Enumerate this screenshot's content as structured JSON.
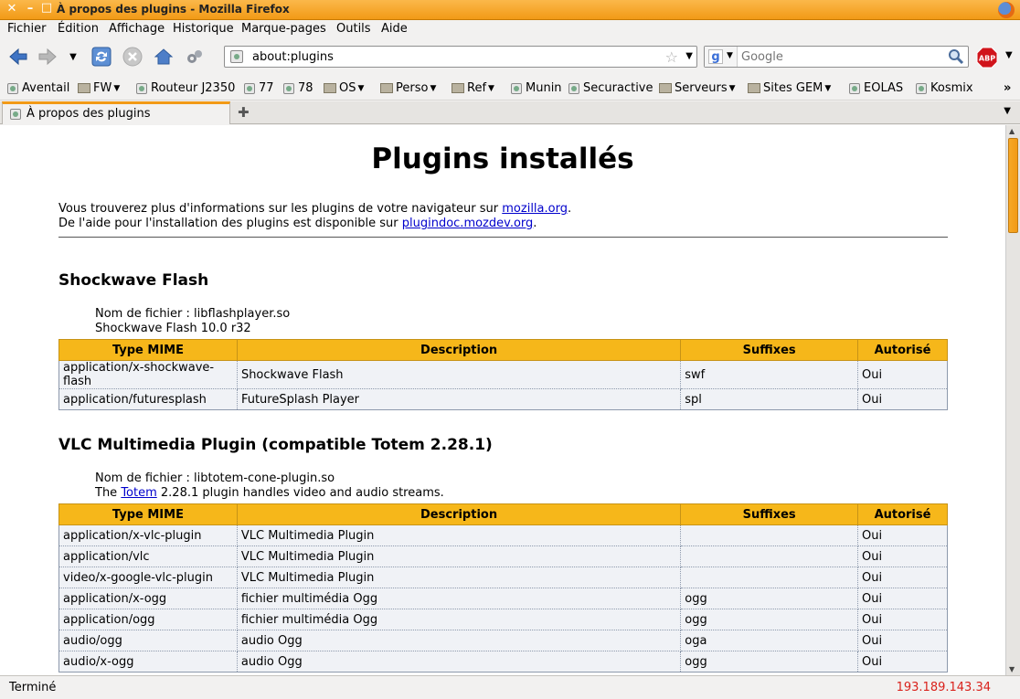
{
  "window": {
    "title": "À propos des plugins - Mozilla Firefox"
  },
  "menubar": [
    "Fichier",
    "Édition",
    "Affichage",
    "Historique",
    "Marque-pages",
    "Outils",
    "Aide"
  ],
  "navbar": {
    "url": "about:plugins",
    "search_placeholder": "Google",
    "search_engine_letter": "g",
    "abp_label": "ABP"
  },
  "bookmarks": [
    {
      "label": "Aventail",
      "kind": "link"
    },
    {
      "label": "FW",
      "kind": "folder"
    },
    {
      "label": "Routeur J2350",
      "kind": "link"
    },
    {
      "label": "77",
      "kind": "link"
    },
    {
      "label": "78",
      "kind": "link"
    },
    {
      "label": "OS",
      "kind": "folder"
    },
    {
      "label": "Perso",
      "kind": "folder"
    },
    {
      "label": "Ref",
      "kind": "folder"
    },
    {
      "label": "Munin",
      "kind": "link"
    },
    {
      "label": "Securactive",
      "kind": "link"
    },
    {
      "label": "Serveurs",
      "kind": "folder"
    },
    {
      "label": "Sites GEM",
      "kind": "folder"
    },
    {
      "label": "EOLAS",
      "kind": "link"
    },
    {
      "label": "Kosmix",
      "kind": "link"
    }
  ],
  "bookmarks_overflow": "»",
  "tab": {
    "label": "À propos des plugins"
  },
  "page": {
    "heading": "Plugins installés",
    "intro1_prefix": "Vous trouverez plus d'informations sur les plugins de votre navigateur sur ",
    "intro1_link": "mozilla.org",
    "intro1_suffix": ".",
    "intro2_prefix": "De l'aide pour l'installation des plugins est disponible sur ",
    "intro2_link": "plugindoc.mozdev.org",
    "intro2_suffix": ".",
    "columns": [
      "Type MIME",
      "Description",
      "Suffixes",
      "Autorisé"
    ],
    "plugins": [
      {
        "name": "Shockwave Flash",
        "filename": "Nom de fichier : libflashplayer.so",
        "desc_prefix": "Shockwave Flash 10.0 r32",
        "desc_link": "",
        "desc_suffix": "",
        "rows": [
          [
            "application/x-shockwave-flash",
            "Shockwave Flash",
            "swf",
            "Oui"
          ],
          [
            "application/futuresplash",
            "FutureSplash Player",
            "spl",
            "Oui"
          ]
        ]
      },
      {
        "name": "VLC Multimedia Plugin (compatible Totem 2.28.1)",
        "filename": "Nom de fichier : libtotem-cone-plugin.so",
        "desc_prefix": "The ",
        "desc_link": "Totem",
        "desc_suffix": " 2.28.1 plugin handles video and audio streams.",
        "rows": [
          [
            "application/x-vlc-plugin",
            "VLC Multimedia Plugin",
            "",
            "Oui"
          ],
          [
            "application/vlc",
            "VLC Multimedia Plugin",
            "",
            "Oui"
          ],
          [
            "video/x-google-vlc-plugin",
            "VLC Multimedia Plugin",
            "",
            "Oui"
          ],
          [
            "application/x-ogg",
            "fichier multimédia Ogg",
            "ogg",
            "Oui"
          ],
          [
            "application/ogg",
            "fichier multimédia Ogg",
            "ogg",
            "Oui"
          ],
          [
            "audio/ogg",
            "audio Ogg",
            "oga",
            "Oui"
          ],
          [
            "audio/x-ogg",
            "audio Ogg",
            "ogg",
            "Oui"
          ]
        ]
      }
    ]
  },
  "status": {
    "text": "Terminé",
    "ip": "193.189.143.34"
  }
}
